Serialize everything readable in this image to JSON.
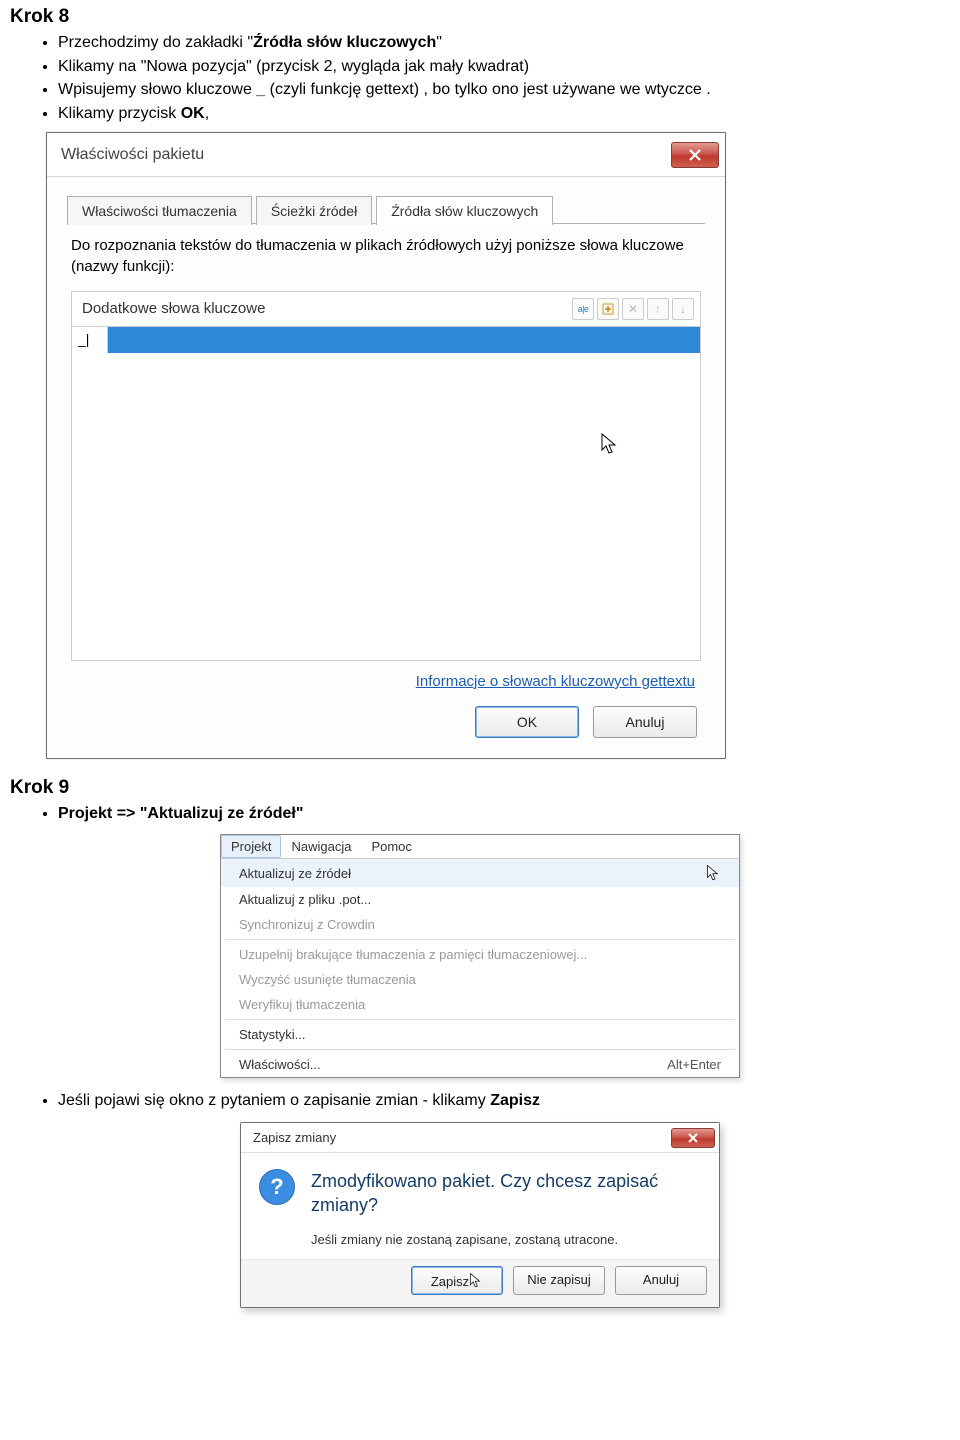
{
  "step8": {
    "title": "Krok 8",
    "bullets": [
      "Przechodzimy do zakładki  \"Źródła słów kluczowych\"",
      "Klikamy na \"Nowa pozycja\" (przycisk 2,  wygląda jak mały kwadrat)",
      "Wpisujemy słowo kluczowe _  (czyli funkcję gettext) , bo tylko ono jest używane we wtyczce .",
      "Klikamy przycisk OK,"
    ]
  },
  "propsDialog": {
    "title": "Właściwości pakietu",
    "tabs": {
      "t1": "Właściwości tłumaczenia",
      "t2": "Ścieżki źródeł",
      "t3": "Źródła słów kluczowych"
    },
    "desc": "Do rozpoznania tekstów do tłumaczenia w plikach źródłowych użyj poniższe słowa kluczowe (nazwy funkcji):",
    "panelTitle": "Dodatkowe słowa kluczowe",
    "tool_aie": "a|e",
    "tool_x": "✕",
    "tool_up": "↑",
    "tool_down": "↓",
    "editValue": "_|",
    "infoLink": "Informacje o słowach kluczowych gettextu",
    "ok": "OK",
    "cancel": "Anuluj"
  },
  "step9": {
    "title": "Krok 9",
    "bullet1": "Projekt => \"Aktualizuj ze źródeł\"",
    "bullet2_pre": "Jeśli pojawi się okno z pytaniem o zapisanie zmian - klikamy ",
    "bullet2_bold": "Zapisz"
  },
  "menu": {
    "bar": {
      "projekt": "Projekt",
      "nawigacja": "Nawigacja",
      "pomoc": "Pomoc"
    },
    "items": {
      "i0": "Aktualizuj ze źródeł",
      "i1": "Aktualizuj z pliku .pot...",
      "i2": "Synchronizuj z Crowdin",
      "i3": "Uzupełnij brakujące tłumaczenia z pamięci tłumaczeniowej...",
      "i4": "Wyczyść usunięte tłumaczenia",
      "i5": "Weryfikuj tłumaczenia",
      "i6": "Statystyki...",
      "i7": "Właściwości...",
      "i7_shortcut": "Alt+Enter"
    }
  },
  "saveDialog": {
    "title": "Zapisz zmiany",
    "msg": "Zmodyfikowano pakiet. Czy chcesz zapisać zmiany?",
    "sub": "Jeśli zmiany nie zostaną zapisane, zostaną utracone.",
    "save": "Zapisz",
    "dontsave": "Nie zapisuj",
    "cancel": "Anuluj",
    "q": "?"
  }
}
